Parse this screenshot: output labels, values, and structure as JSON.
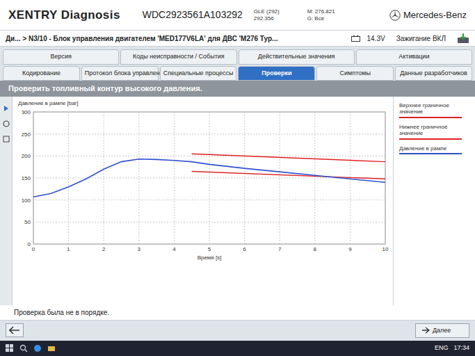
{
  "app": {
    "title": "XENTRY Diagnosis",
    "brand": "Mercedes-Benz"
  },
  "vehicle": {
    "vin": "WDC2923561A103292",
    "model": "GLE (292)",
    "code": "292.356",
    "engine": "M: 276.821",
    "gearbox": "G: Все"
  },
  "breadcrumb": "Ди... > N3/10 - Блок управления двигателем 'MED177V6LA' для ДВС 'M276 Тур...",
  "status": {
    "voltage": "14.3V",
    "ignition": "Зажигание ВКЛ"
  },
  "tabs_top": [
    {
      "label": "Версия",
      "selected": false
    },
    {
      "label": "Коды неисправности / События",
      "selected": false
    },
    {
      "label": "Действительные значения",
      "selected": false
    },
    {
      "label": "Активации",
      "selected": false
    }
  ],
  "tabs_bottom": [
    {
      "label": "Кодирование",
      "selected": false
    },
    {
      "label": "Протокол блока управления",
      "selected": false
    },
    {
      "label": "Специальные процессы",
      "selected": false
    },
    {
      "label": "Проверки",
      "selected": true
    },
    {
      "label": "Симптомы",
      "selected": false
    },
    {
      "label": "Данные разработчиков",
      "selected": false
    }
  ],
  "panel_title": "Проверить топливный контур высокого давления.",
  "chart": {
    "y_axis_title": "Давление в рампе [bar]",
    "x_axis_title": "Время [s]",
    "y_ticks": [
      "0",
      "50",
      "100",
      "150",
      "200",
      "250",
      "300"
    ],
    "x_ticks": [
      "0",
      "1",
      "2",
      "3",
      "4",
      "5",
      "6",
      "7",
      "8",
      "9",
      "10"
    ],
    "series": [
      {
        "name": "Верхнее граничное значение",
        "color": "#e02020",
        "x": [
          4.5,
          10
        ],
        "values": [
          205,
          187
        ]
      },
      {
        "name": "Нижнее граничное значение",
        "color": "#e02020",
        "x": [
          4.5,
          10
        ],
        "values": [
          165,
          148
        ]
      },
      {
        "name": "Давление в рампе",
        "color": "#2f4fd0",
        "x": [
          0,
          0.5,
          1,
          1.5,
          2,
          2.5,
          3,
          3.5,
          4,
          4.5,
          5,
          6,
          7,
          8,
          9,
          10
        ],
        "values": [
          107,
          115,
          130,
          148,
          170,
          187,
          193,
          192,
          190,
          187,
          181,
          172,
          164,
          156,
          148,
          140
        ]
      }
    ]
  },
  "result": "Проверка была не в порядке.",
  "buttons": {
    "next": "Далее"
  },
  "taskbar": {
    "language": "ENG",
    "time": "17:34"
  }
}
